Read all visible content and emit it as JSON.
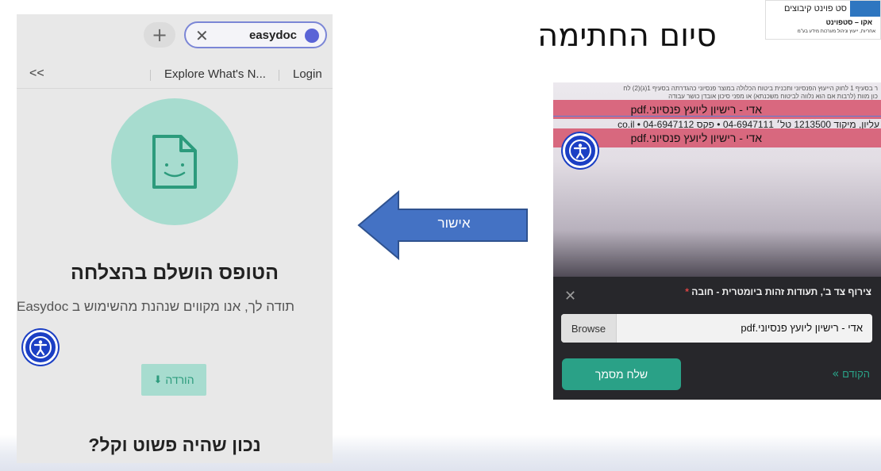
{
  "slide": {
    "heading": "סיום החתימה"
  },
  "logo": {
    "line1": "סט פוינט קיבוצים",
    "line2": "אקו – סטפוינט",
    "line3": "אחריות, ייעוץ וניהול מערכות מידע בע\"מ"
  },
  "arrow": {
    "label": "אישור",
    "color": "#4472c4"
  },
  "left_phone": {
    "browser": {
      "new_tab_symbol": "+",
      "close_symbol": "✕",
      "url_text": "easydoc"
    },
    "nav": {
      "back": "<<",
      "explore": "Explore What's N...",
      "login": "Login"
    },
    "title": "הטופס הושלם בהצלחה",
    "subtitle": "תודה לך, אנו מקווים שנהנת מהשימוש ב Easydoc",
    "download_label": "הורדה",
    "bottom_text": "נכון שהיה פשוט וקל?",
    "accent": "#a7dccf"
  },
  "right_phone": {
    "doc_lines": [
      "ר בסעיף 1 לחוק הייעוץ הפנסיוני ותכנית ביטוח הכלולה במוצר פנסיוני כהגדרתה בסעיף 1(ג)(2) לח",
      "כון מוות (לרבות אם הוא נלווה לביטוח משכנתא) או מפני סיכון אובדן כושר עבודה"
    ],
    "pink_label": "אדי - רישיון ליועץ פנסיוני.pdf",
    "address_line": "עליון, מיקוד 1213500 טל׳ 04-6947111 • פקס 04-6947112 • co.il",
    "panel": {
      "title": "צירוף צד ב', תעודות זהות ביומטרית - חובה",
      "required_mark": "*",
      "close_symbol": "✕",
      "browse_label": "Browse",
      "file_name": "אדי - רישיון ליועץ פנסיוני.pdf",
      "send_label": "שלח מסמך",
      "prev_label": "הקודם",
      "prev_chevron": "»"
    }
  }
}
